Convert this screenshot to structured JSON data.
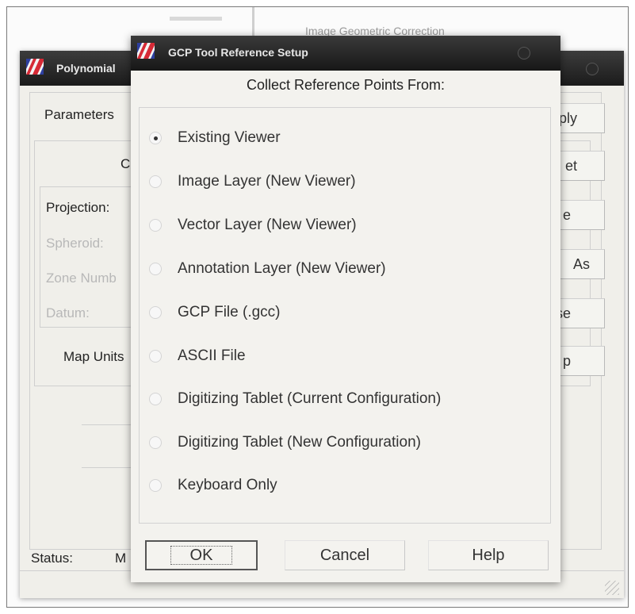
{
  "background": {
    "partial_window_title": "Image Geometric Correction"
  },
  "polynomial_window": {
    "title": "Polynomial",
    "labels": {
      "parameters": "Parameters",
      "c": "C",
      "projection": "Projection:",
      "spheroid": "Spheroid:",
      "zone_number": "Zone Numb",
      "datum": "Datum:",
      "map_units": "Map Units",
      "status": "Status:",
      "status_value": "M"
    },
    "side_buttons": [
      "ply",
      "et",
      "e",
      "As",
      "se",
      "p"
    ]
  },
  "gcp_dialog": {
    "title": "GCP Tool Reference Setup",
    "heading": "Collect Reference Points From:",
    "options": [
      {
        "label": "Existing Viewer",
        "checked": true
      },
      {
        "label": "Image Layer (New Viewer)",
        "checked": false
      },
      {
        "label": "Vector Layer (New Viewer)",
        "checked": false
      },
      {
        "label": "Annotation Layer (New Viewer)",
        "checked": false
      },
      {
        "label": "GCP File (.gcc)",
        "checked": false
      },
      {
        "label": "ASCII File",
        "checked": false
      },
      {
        "label": "Digitizing Tablet (Current Configuration)",
        "checked": false
      },
      {
        "label": "Digitizing Tablet (New Configuration)",
        "checked": false
      },
      {
        "label": "Keyboard Only",
        "checked": false
      }
    ],
    "buttons": {
      "ok": "OK",
      "cancel": "Cancel",
      "help": "Help"
    }
  },
  "icons": {
    "app_logo": "erdas-logo-icon",
    "window_control": "window-control-icon"
  },
  "colors": {
    "titlebar": "#1b1b1b",
    "window_bg": "#f0efea",
    "logo_red": "#d62a36",
    "logo_blue": "#2d3fa0"
  }
}
